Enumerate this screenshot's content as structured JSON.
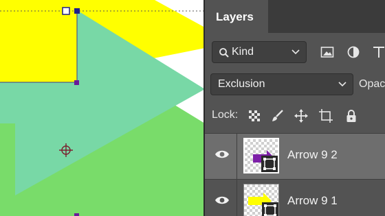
{
  "panel": {
    "tab_title": "Layers",
    "filter": {
      "label": "Kind"
    },
    "blend_mode": {
      "value": "Exclusion"
    },
    "opacity_label": "Opac",
    "lock_label": "Lock:",
    "layers": [
      {
        "name": "Arrow 9 2",
        "visible": true,
        "selected": true,
        "arrow_color": "#7d1fa8"
      },
      {
        "name": "Arrow 9 1",
        "visible": true,
        "selected": false,
        "arrow_color": "#ffff00"
      }
    ]
  },
  "canvas": {
    "colors": {
      "yellow": "#ffff00",
      "teal": "#78d8a6",
      "green": "#79dc6a",
      "handle": "#1f1f8c",
      "crosshair": "#7a1f2e"
    }
  }
}
